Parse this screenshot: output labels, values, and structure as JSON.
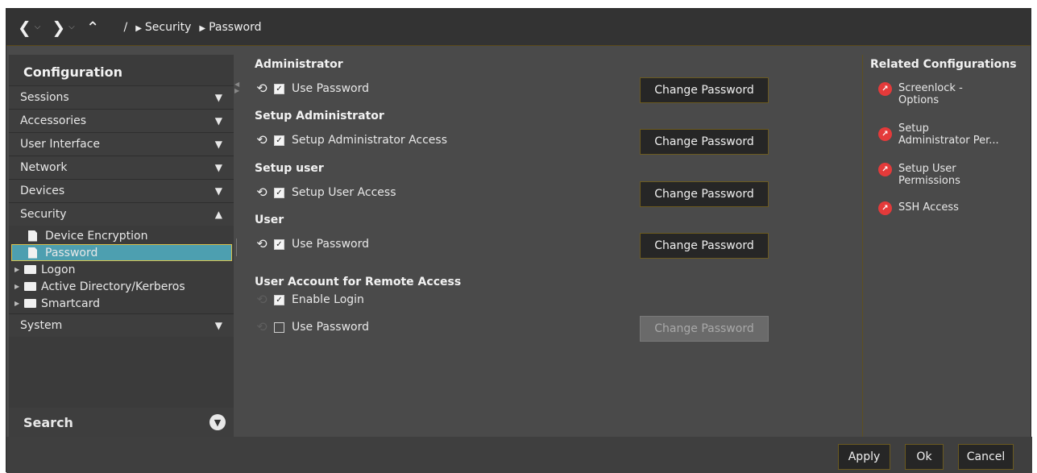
{
  "nav": {
    "back_icon": "chevron-left-icon",
    "forward_icon": "chevron-right-icon",
    "up_icon": "chevron-up-icon",
    "root": "/",
    "crumbs": [
      "Security",
      "Password"
    ]
  },
  "sidebar": {
    "title": "Configuration",
    "categories": [
      {
        "label": "Sessions",
        "state": "collapsed"
      },
      {
        "label": "Accessories",
        "state": "collapsed"
      },
      {
        "label": "User Interface",
        "state": "collapsed"
      },
      {
        "label": "Network",
        "state": "collapsed"
      },
      {
        "label": "Devices",
        "state": "collapsed"
      },
      {
        "label": "Security",
        "state": "expanded"
      },
      {
        "label": "System",
        "state": "collapsed"
      }
    ],
    "security_items": [
      "Device Encryption",
      "Password"
    ],
    "security_folders": [
      "Logon",
      "Active Directory/Kerberos",
      "Smartcard"
    ],
    "selected": "Password",
    "search_label": "Search"
  },
  "main": {
    "sections": [
      {
        "title": "Administrator"
      },
      {
        "title": "Setup Administrator"
      },
      {
        "title": "Setup user"
      },
      {
        "title": "User"
      },
      {
        "title": "User Account for Remote Access"
      }
    ],
    "rows": [
      {
        "label": "Use Password",
        "checked": true,
        "button": "Change Password",
        "enabled": true
      },
      {
        "label": "Setup Administrator Access",
        "checked": true,
        "button": "Change Password",
        "enabled": true
      },
      {
        "label": "Setup User Access",
        "checked": true,
        "button": "Change Password",
        "enabled": true
      },
      {
        "label": "Use Password",
        "checked": true,
        "button": "Change Password",
        "enabled": true
      },
      {
        "label": "Enable Login",
        "checked": true,
        "enabled": false
      },
      {
        "label": "Use Password",
        "checked": false,
        "button": "Change Password",
        "enabled": false
      }
    ]
  },
  "related": {
    "title": "Related Configurations",
    "items": [
      {
        "label_line1": "Screenlock -",
        "label_line2": "Options"
      },
      {
        "label_line1": "Setup",
        "label_line2": "Administrator Per..."
      },
      {
        "label_line1": "Setup User",
        "label_line2": "Permissions"
      },
      {
        "label_line1": "SSH Access",
        "label_line2": ""
      }
    ]
  },
  "footer": {
    "apply": "Apply",
    "ok": "Ok",
    "cancel": "Cancel"
  },
  "colors": {
    "accent_border": "#6b5a1f",
    "selection": "#4d9fb0",
    "link_icon": "#e43a3a"
  }
}
